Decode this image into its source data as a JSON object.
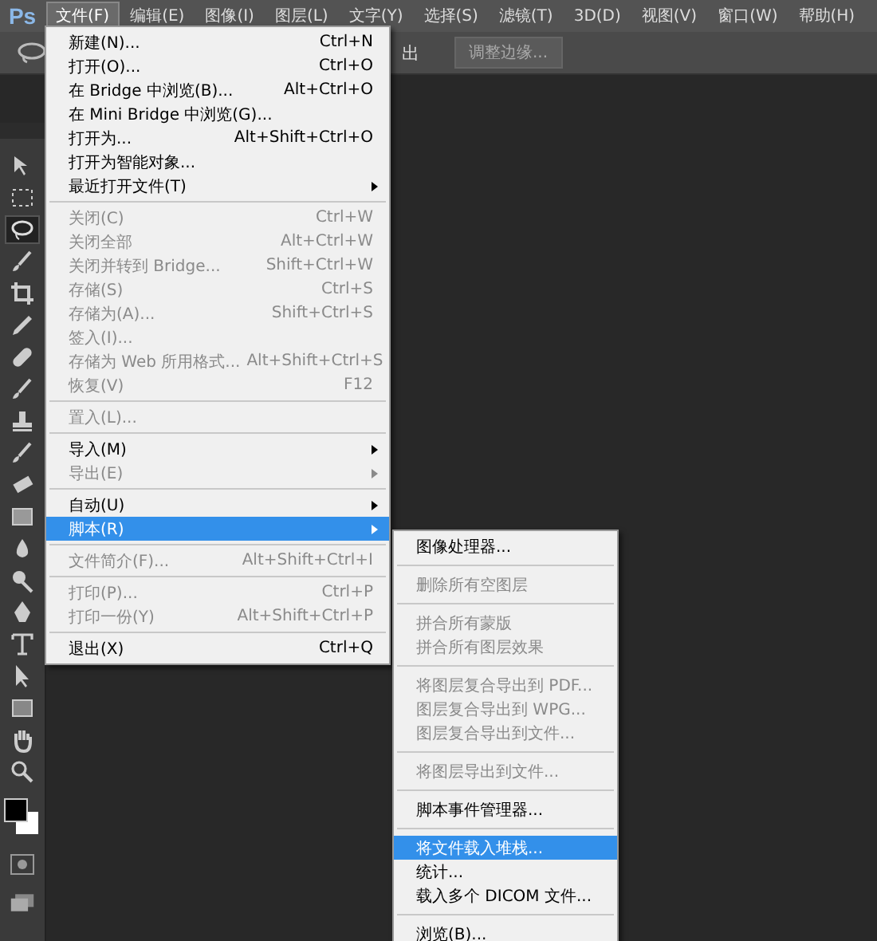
{
  "menubar": {
    "logo": "Ps",
    "menus": [
      {
        "label": "文件(F)",
        "selected": true
      },
      {
        "label": "编辑(E)",
        "selected": false
      },
      {
        "label": "图像(I)",
        "selected": false
      },
      {
        "label": "图层(L)",
        "selected": false
      },
      {
        "label": "文字(Y)",
        "selected": false
      },
      {
        "label": "选择(S)",
        "selected": false
      },
      {
        "label": "滤镜(T)",
        "selected": false
      },
      {
        "label": "3D(D)",
        "selected": false
      },
      {
        "label": "视图(V)",
        "selected": false
      },
      {
        "label": "窗口(W)",
        "selected": false
      },
      {
        "label": "帮助(H)",
        "selected": false
      }
    ]
  },
  "options_bar": {
    "partial_label": "出",
    "button": "调整边缘..."
  },
  "toolbar": {
    "tools": [
      {
        "kind": "move",
        "selected": false
      },
      {
        "kind": "marquee",
        "selected": false
      },
      {
        "kind": "lasso",
        "selected": true
      },
      {
        "kind": "brush",
        "selected": false
      },
      {
        "kind": "crop",
        "selected": false
      },
      {
        "kind": "eyedropper",
        "selected": false
      },
      {
        "kind": "heal",
        "selected": false
      },
      {
        "kind": "brush",
        "selected": false
      },
      {
        "kind": "stamp",
        "selected": false
      },
      {
        "kind": "brush",
        "selected": false
      },
      {
        "kind": "eraser",
        "selected": false
      },
      {
        "kind": "gradient",
        "selected": false
      },
      {
        "kind": "drop",
        "selected": false
      },
      {
        "kind": "dodge",
        "selected": false
      },
      {
        "kind": "pen",
        "selected": false
      },
      {
        "kind": "type",
        "selected": false
      },
      {
        "kind": "pointer",
        "selected": false
      },
      {
        "kind": "shape",
        "selected": false
      },
      {
        "kind": "hand",
        "selected": false
      },
      {
        "kind": "zoom",
        "selected": false
      }
    ]
  },
  "file_menu": {
    "sections": [
      [
        {
          "label": "新建(N)...",
          "shortcut": "Ctrl+N",
          "disabled": false,
          "has_submenu": false,
          "selected": false
        },
        {
          "label": "打开(O)...",
          "shortcut": "Ctrl+O",
          "disabled": false,
          "has_submenu": false,
          "selected": false
        },
        {
          "label": "在 Bridge 中浏览(B)...",
          "shortcut": "Alt+Ctrl+O",
          "disabled": false,
          "has_submenu": false,
          "selected": false
        },
        {
          "label": "在 Mini Bridge 中浏览(G)...",
          "disabled": false,
          "has_submenu": false,
          "selected": false
        },
        {
          "label": "打开为...",
          "shortcut": "Alt+Shift+Ctrl+O",
          "disabled": false,
          "has_submenu": false,
          "selected": false
        },
        {
          "label": "打开为智能对象...",
          "disabled": false,
          "has_submenu": false,
          "selected": false
        },
        {
          "label": "最近打开文件(T)",
          "disabled": false,
          "has_submenu": true,
          "selected": false
        }
      ],
      [
        {
          "label": "关闭(C)",
          "shortcut": "Ctrl+W",
          "disabled": true,
          "has_submenu": false,
          "selected": false
        },
        {
          "label": "关闭全部",
          "shortcut": "Alt+Ctrl+W",
          "disabled": true,
          "has_submenu": false,
          "selected": false
        },
        {
          "label": "关闭并转到 Bridge...",
          "shortcut": "Shift+Ctrl+W",
          "disabled": true,
          "has_submenu": false,
          "selected": false
        },
        {
          "label": "存储(S)",
          "shortcut": "Ctrl+S",
          "disabled": true,
          "has_submenu": false,
          "selected": false
        },
        {
          "label": "存储为(A)...",
          "shortcut": "Shift+Ctrl+S",
          "disabled": true,
          "has_submenu": false,
          "selected": false
        },
        {
          "label": "签入(I)...",
          "disabled": true,
          "has_submenu": false,
          "selected": false
        },
        {
          "label": "存储为 Web 所用格式...",
          "shortcut": "Alt+Shift+Ctrl+S",
          "disabled": true,
          "has_submenu": false,
          "selected": false
        },
        {
          "label": "恢复(V)",
          "shortcut": "F12",
          "disabled": true,
          "has_submenu": false,
          "selected": false
        }
      ],
      [
        {
          "label": "置入(L)...",
          "disabled": true,
          "has_submenu": false,
          "selected": false
        }
      ],
      [
        {
          "label": "导入(M)",
          "disabled": false,
          "has_submenu": true,
          "selected": false
        },
        {
          "label": "导出(E)",
          "disabled": true,
          "has_submenu": true,
          "selected": false
        }
      ],
      [
        {
          "label": "自动(U)",
          "disabled": false,
          "has_submenu": true,
          "selected": false
        },
        {
          "label": "脚本(R)",
          "disabled": false,
          "has_submenu": true,
          "selected": true
        }
      ],
      [
        {
          "label": "文件简介(F)...",
          "shortcut": "Alt+Shift+Ctrl+I",
          "disabled": true,
          "has_submenu": false,
          "selected": false
        }
      ],
      [
        {
          "label": "打印(P)...",
          "shortcut": "Ctrl+P",
          "disabled": true,
          "has_submenu": false,
          "selected": false
        },
        {
          "label": "打印一份(Y)",
          "shortcut": "Alt+Shift+Ctrl+P",
          "disabled": true,
          "has_submenu": false,
          "selected": false
        }
      ],
      [
        {
          "label": "退出(X)",
          "shortcut": "Ctrl+Q",
          "disabled": false,
          "has_submenu": false,
          "selected": false
        }
      ]
    ]
  },
  "scripts_submenu": {
    "sections": [
      [
        {
          "label": "图像处理器...",
          "disabled": false,
          "selected": false
        }
      ],
      [
        {
          "label": "删除所有空图层",
          "disabled": true,
          "selected": false
        }
      ],
      [
        {
          "label": "拼合所有蒙版",
          "disabled": true,
          "selected": false
        },
        {
          "label": "拼合所有图层效果",
          "disabled": true,
          "selected": false
        }
      ],
      [
        {
          "label": "将图层复合导出到 PDF...",
          "disabled": true,
          "selected": false
        },
        {
          "label": "图层复合导出到 WPG...",
          "disabled": true,
          "selected": false
        },
        {
          "label": "图层复合导出到文件...",
          "disabled": true,
          "selected": false
        }
      ],
      [
        {
          "label": "将图层导出到文件...",
          "disabled": true,
          "selected": false
        }
      ],
      [
        {
          "label": "脚本事件管理器...",
          "disabled": false,
          "selected": false
        }
      ],
      [
        {
          "label": "将文件载入堆栈...",
          "disabled": false,
          "selected": true
        },
        {
          "label": "统计...",
          "disabled": false,
          "selected": false
        },
        {
          "label": "载入多个 DICOM 文件...",
          "disabled": false,
          "selected": false
        }
      ],
      [
        {
          "label": "浏览(B)...",
          "disabled": false,
          "selected": false
        }
      ]
    ]
  }
}
